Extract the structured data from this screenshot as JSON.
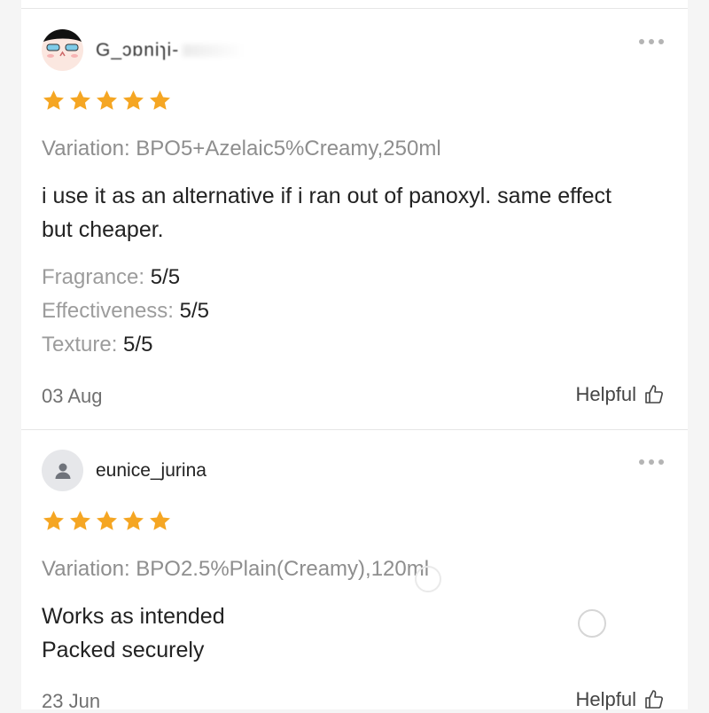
{
  "reviews": [
    {
      "username": "G_ɔɒniɿi-",
      "rating": 5,
      "variation": "Variation: BPO5+Azelaic5%Creamy,250ml",
      "body_lines": [
        "i use it as an alternative if i ran out of panoxyl. same effect",
        "but cheaper."
      ],
      "attributes": [
        {
          "key": "Fragrance:",
          "value": "5/5"
        },
        {
          "key": "Effectiveness:",
          "value": "5/5"
        },
        {
          "key": "Texture:",
          "value": "5/5"
        }
      ],
      "date": "03 Aug",
      "helpful_label": "Helpful"
    },
    {
      "username": "eunice_jurina",
      "rating": 5,
      "variation": "Variation: BPO2.5%Plain(Creamy),120ml",
      "body_lines": [
        "Works as intended",
        "Packed securely"
      ],
      "date": "23 Jun",
      "helpful_label": "Helpful"
    }
  ],
  "colors": {
    "star": "#f5a623",
    "muted": "#8e8e8e",
    "divider": "#e6e6e6"
  },
  "icons": {
    "more": "more-dots-icon",
    "helpful": "thumbs-up-icon",
    "star": "star-icon",
    "default_avatar": "user-icon"
  }
}
